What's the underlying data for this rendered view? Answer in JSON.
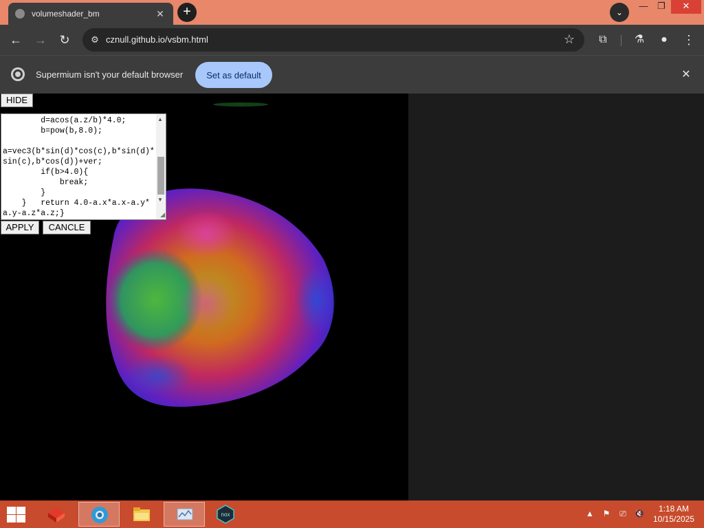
{
  "tab": {
    "title": "volumeshader_bm",
    "close": "✕"
  },
  "toolbar": {
    "url": "cznull.github.io/vsbm.html"
  },
  "infobar": {
    "message": "Supermium isn't your default browser",
    "set_default": "Set as default"
  },
  "panel": {
    "hide": "HIDE",
    "apply": "APPLY",
    "cancel": "CANCLE",
    "code": "        d=acos(a.z/b)*4.0;\n        b=pow(b,8.0);\n\na=vec3(b*sin(d)*cos(c),b*sin(d)*sin(c),b*cos(d))+ver;\n        if(b>4.0){\n            break;\n        }\n    }   return 4.0-a.x*a.x-a.y*a.y-a.z*a.z;}"
  },
  "taskbar": {
    "time": "1:18 AM",
    "date": "10/15/2025"
  },
  "colors": {
    "tabstrip": "#e8876a",
    "toolbar": "#3c3c3c",
    "taskbar": "#c74b2c",
    "set_default_bg": "#a8c7fa"
  }
}
